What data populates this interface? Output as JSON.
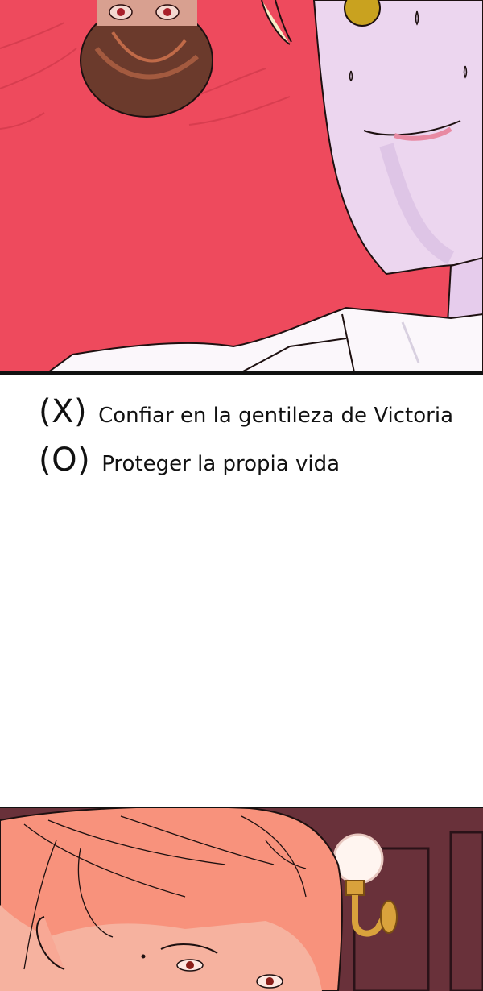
{
  "choices": [
    {
      "mark": "(X)",
      "text": "Confiar en la gentileza de Victoria"
    },
    {
      "mark": "(O)",
      "text": "Proteger la propia vida"
    }
  ],
  "colors": {
    "top_background": "#ee4a5d",
    "skin_lavender": "#ecd6ef",
    "bottom_skin": "#f6a58e",
    "bottom_wall": "#4a2630",
    "lamp_brass": "#d9a23c",
    "border": "#111111"
  }
}
